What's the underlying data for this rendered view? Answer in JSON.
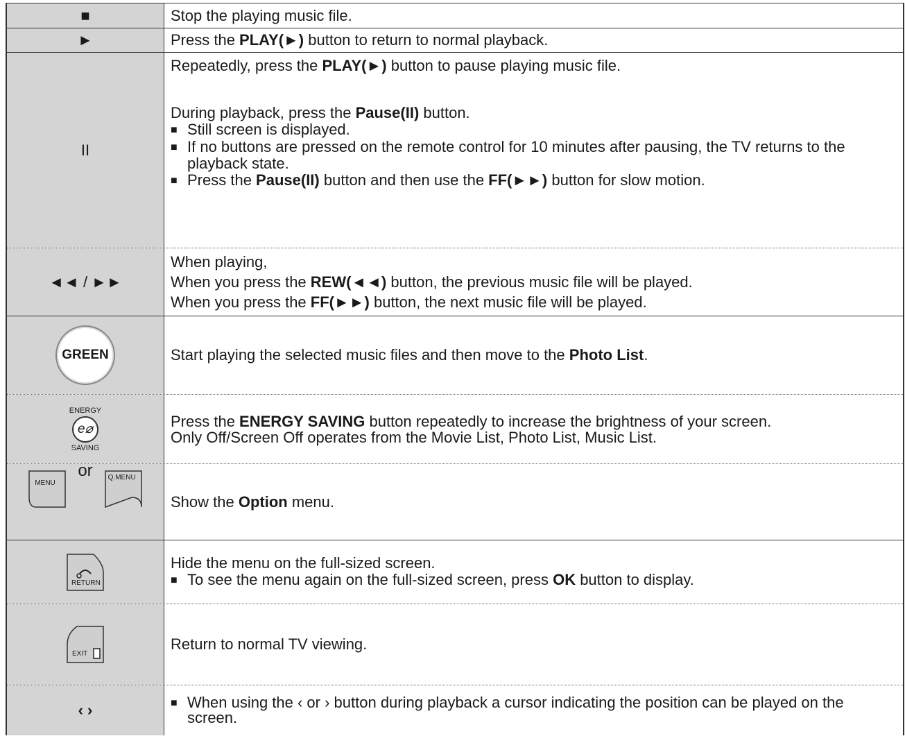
{
  "rows": [
    {
      "key": "■",
      "desc": "Stop the playing music file."
    },
    {
      "key": "►",
      "pre": "Press the ",
      "bold": "PLAY(►)",
      "post": " button to return to normal playback."
    },
    {
      "key": "II",
      "line1_pre": "Repeatedly, press the ",
      "line1_bold": "PLAY(►)",
      "line1_post": " button to pause playing music file.",
      "line2_pre": "During playback, press the ",
      "line2_bold": "Pause(II)",
      "line2_post": " button.",
      "b1": "Still screen is displayed.",
      "b2": "If no buttons are pressed on the remote control for 10 minutes after pausing, the TV returns to the playback state.",
      "b3_pre": "Press the ",
      "b3_bold1": "Pause(II)",
      "b3_mid": " button and then use the ",
      "b3_bold2": "FF(►►)",
      "b3_post": " button for slow motion."
    },
    {
      "key": "◄◄ / ►►",
      "l1": "When playing,",
      "l2_pre": "When you press the ",
      "l2_bold": "REW(◄◄)",
      "l2_post": " button, the previous music file will be played.",
      "l3_pre": "When you press the ",
      "l3_bold": "FF(►►)",
      "l3_post": " button, the next music file will be played."
    },
    {
      "key": "GREEN",
      "pre": "Start playing the selected music files and then move to the ",
      "bold": "Photo List",
      "post": "."
    },
    {
      "key_top": "ENERGY",
      "key_icon": "e⌀",
      "key_bottom": "SAVING",
      "pre": "Press the ",
      "bold": "ENERGY SAVING",
      "post": " button repeatedly to increase the brightness of your screen.",
      "l2": "Only Off/Screen Off operates from the Movie List, Photo List, Music List."
    },
    {
      "key_a": "MENU",
      "key_or": "or",
      "key_b": "Q.MENU",
      "pre": "Show the ",
      "bold": "Option",
      "post": " menu."
    },
    {
      "key": "RETURN",
      "l1": "Hide the menu on the full-sized screen.",
      "b_pre": "To see the menu again on the full-sized screen, press ",
      "b_bold": "OK",
      "b_post": " button to display."
    },
    {
      "key": "EXIT",
      "desc": "Return to normal TV viewing."
    },
    {
      "key": "‹ ›",
      "b": "When using the ‹ or › button during playback a cursor indicating the position can be played on the screen."
    }
  ],
  "bullet": "■"
}
